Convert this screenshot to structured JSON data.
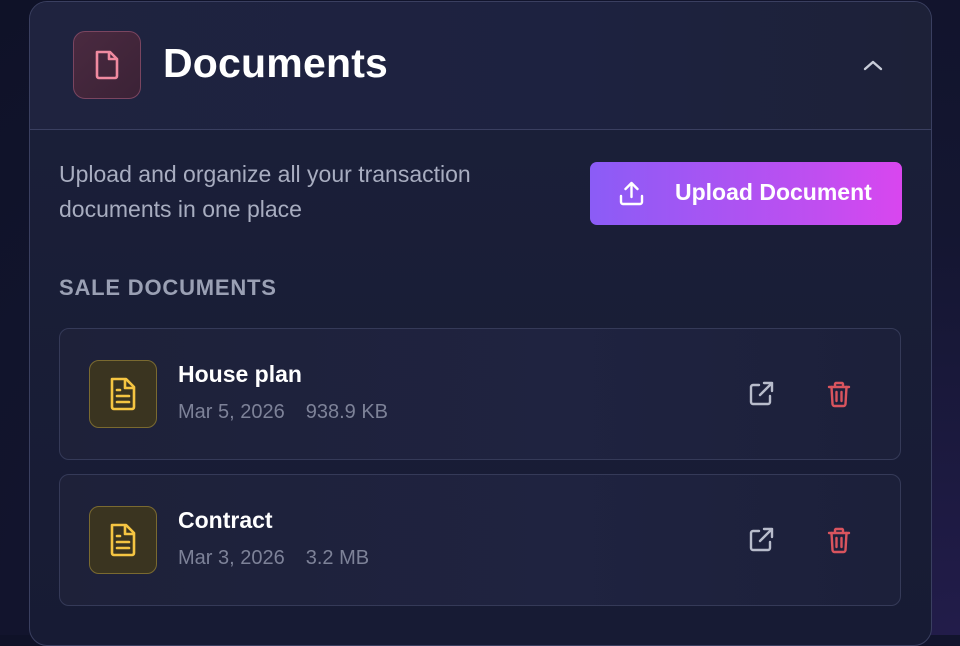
{
  "header": {
    "title": "Documents",
    "icon": "document-icon",
    "collapse_icon": "chevron-up-icon"
  },
  "description": "Upload and organize all your transaction documents in one place",
  "upload_button": {
    "label": "Upload Document",
    "icon": "upload-icon"
  },
  "section": {
    "title": "SALE DOCUMENTS"
  },
  "documents": [
    {
      "name": "House plan",
      "date": "Mar 5, 2026",
      "size": "938.9 KB",
      "icon": "file-text-icon"
    },
    {
      "name": "Contract",
      "date": "Mar 3, 2026",
      "size": "3.2 MB",
      "icon": "file-text-icon"
    }
  ],
  "colors": {
    "accent_start": "#8b5cf6",
    "accent_end": "#d946ef",
    "doc_icon": "#f5c542",
    "header_icon": "#f08aa0",
    "delete": "#d9545e"
  }
}
